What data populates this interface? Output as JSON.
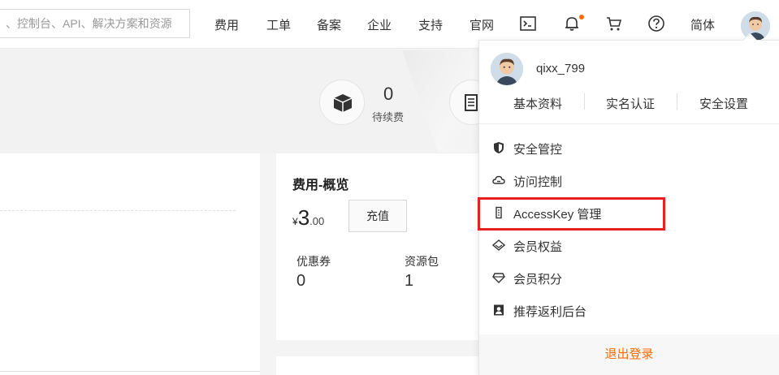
{
  "search": {
    "placeholder": "、控制台、API、解决方案和资源"
  },
  "nav": {
    "items": [
      "费用",
      "工单",
      "备案",
      "企业",
      "支持",
      "官网"
    ],
    "lang": "简体",
    "icons": [
      "terminal-icon",
      "bell-icon",
      "cart-icon",
      "help-icon"
    ]
  },
  "stats": {
    "pending_count": "0",
    "pending_label": "待续费"
  },
  "fee_card": {
    "title": "费用-概览",
    "currency": "¥",
    "amount_int": "3",
    "amount_dec": ".00",
    "recharge_label": "充值",
    "coupon_label": "优惠券",
    "coupon_value": "0",
    "package_label": "资源包",
    "package_value": "1"
  },
  "user_menu": {
    "username": "qixx_799",
    "links": [
      "基本资料",
      "实名认证",
      "安全设置"
    ],
    "items": [
      {
        "label": "安全管控",
        "icon": "shield-icon"
      },
      {
        "label": "访问控制",
        "icon": "cloud-icon"
      },
      {
        "label": "AccessKey 管理",
        "icon": "key-icon"
      },
      {
        "label": "会员权益",
        "icon": "diamond-icon"
      },
      {
        "label": "会员积分",
        "icon": "gem-icon"
      },
      {
        "label": "推荐返利后台",
        "icon": "portrait-icon"
      }
    ],
    "logout_label": "退出登录"
  },
  "colors": {
    "accent": "#ff6a00",
    "highlight": "#e8211c"
  }
}
